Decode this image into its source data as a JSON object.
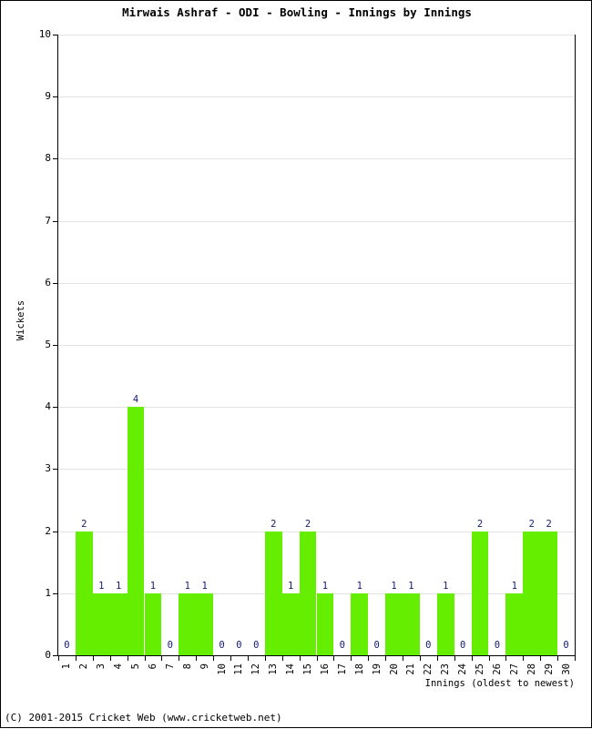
{
  "chart_data": {
    "type": "bar",
    "title": "Mirwais Ashraf - ODI - Bowling - Innings by Innings",
    "xlabel": "Innings (oldest to newest)",
    "ylabel": "Wickets",
    "ylim": [
      0,
      10
    ],
    "yticks": [
      0,
      1,
      2,
      3,
      4,
      5,
      6,
      7,
      8,
      9,
      10
    ],
    "grid": true,
    "legend": null,
    "bar_color": "#66ee00",
    "value_label_color": "#151b77",
    "categories": [
      "1",
      "2",
      "3",
      "4",
      "5",
      "6",
      "7",
      "8",
      "9",
      "10",
      "11",
      "12",
      "13",
      "14",
      "15",
      "16",
      "17",
      "18",
      "19",
      "20",
      "21",
      "22",
      "23",
      "24",
      "25",
      "26",
      "27",
      "28",
      "29",
      "30"
    ],
    "values": [
      0,
      2,
      1,
      1,
      4,
      1,
      0,
      1,
      1,
      0,
      0,
      0,
      2,
      1,
      2,
      1,
      0,
      1,
      0,
      1,
      1,
      0,
      1,
      0,
      2,
      0,
      1,
      2,
      2,
      0
    ],
    "value_labels": [
      "0",
      "2",
      "1",
      "1",
      "4",
      "1",
      "0",
      "1",
      "1",
      "0",
      "0",
      "0",
      "2",
      "1",
      "2",
      "1",
      "0",
      "1",
      "0",
      "1",
      "1",
      "0",
      "1",
      "0",
      "2",
      "0",
      "1",
      "2",
      "2",
      "0"
    ]
  },
  "footer": {
    "copyright": "(C) 2001-2015 Cricket Web (www.cricketweb.net)"
  }
}
